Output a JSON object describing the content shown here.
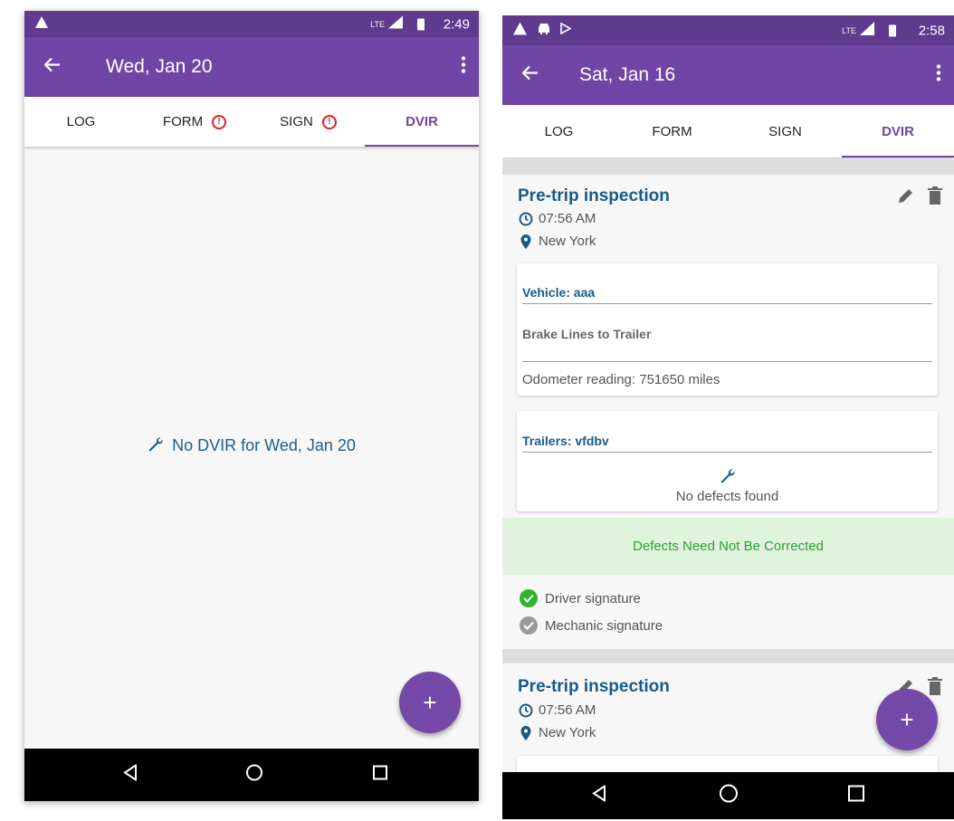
{
  "left_screen": {
    "status_bar": {
      "time": "2:49",
      "network": "LTE"
    },
    "app_bar": {
      "title": "Wed, Jan 20"
    },
    "tabs": [
      {
        "label": "LOG",
        "warning": false,
        "active": false
      },
      {
        "label": "FORM",
        "warning": true,
        "active": false
      },
      {
        "label": "SIGN",
        "warning": true,
        "active": false
      },
      {
        "label": "DVIR",
        "warning": false,
        "active": true
      }
    ],
    "empty_message": "No DVIR for Wed, Jan 20",
    "fab_label": "+"
  },
  "right_screen": {
    "status_bar": {
      "time": "2:58",
      "network": "LTE"
    },
    "app_bar": {
      "title": "Sat, Jan 16"
    },
    "tabs": [
      {
        "label": "LOG",
        "active": false
      },
      {
        "label": "FORM",
        "active": false
      },
      {
        "label": "SIGN",
        "active": false
      },
      {
        "label": "DVIR",
        "active": true
      }
    ],
    "inspections": [
      {
        "title": "Pre-trip inspection",
        "time": "07:56 AM",
        "location": "New York",
        "vehicle_card": {
          "header": "Vehicle: aaa",
          "defect": "Brake Lines to Trailer",
          "odometer": "Odometer reading: 751650 miles"
        },
        "trailer_card": {
          "header": "Trailers: vfdbv",
          "no_defects": "No defects found"
        },
        "status_banner": "Defects Need Not Be Corrected",
        "signatures": [
          {
            "label": "Driver signature",
            "signed": true
          },
          {
            "label": "Mechanic signature",
            "signed": false
          }
        ]
      },
      {
        "title": "Pre-trip inspection",
        "time": "07:56 AM",
        "location": "New York"
      }
    ],
    "fab_label": "+"
  },
  "colors": {
    "status_bar": "#5f3a8f",
    "app_bar": "#7045a5",
    "accent_blue": "#175b8a",
    "success_green": "#2fa12e",
    "warning_red": "#e02020"
  }
}
